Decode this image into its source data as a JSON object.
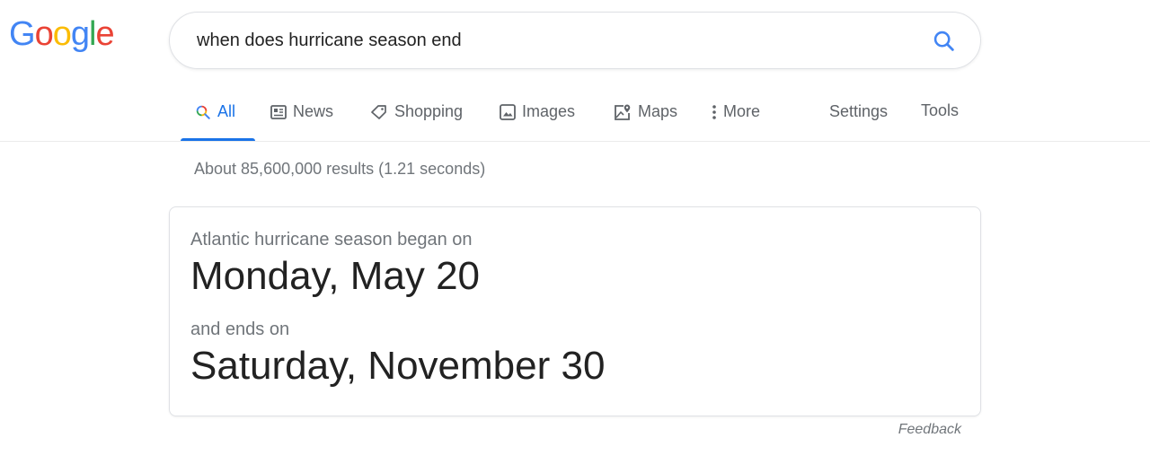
{
  "logo": {
    "letters": [
      "G",
      "o",
      "o",
      "g",
      "l",
      "e"
    ],
    "colors": [
      "#4285f4",
      "#ea4335",
      "#fbbc05",
      "#4285f4",
      "#34a853",
      "#ea4335"
    ]
  },
  "search": {
    "query": "when does hurricane season end",
    "icon": "search-icon",
    "icon_color": "#4285f4"
  },
  "tabs": [
    {
      "label": "All",
      "icon": "search-icon",
      "active": true
    },
    {
      "label": "News",
      "icon": "newspaper-icon",
      "active": false
    },
    {
      "label": "Shopping",
      "icon": "tag-icon",
      "active": false
    },
    {
      "label": "Images",
      "icon": "image-icon",
      "active": false
    },
    {
      "label": "Maps",
      "icon": "map-pin-icon",
      "active": false
    },
    {
      "label": "More",
      "icon": "more-vertical-icon",
      "active": false
    }
  ],
  "tools": {
    "settings_label": "Settings",
    "tools_label": "Tools"
  },
  "result_stats": "About 85,600,000 results (1.21 seconds)",
  "answer_card": {
    "start_label": "Atlantic hurricane season began on",
    "start_date": "Monday, May 20",
    "end_label": "and ends on",
    "end_date": "Saturday, November 30"
  },
  "feedback_label": "Feedback",
  "colors": {
    "accent": "#1a73e8",
    "text_secondary": "#70757a",
    "border": "#dfe1e5"
  }
}
